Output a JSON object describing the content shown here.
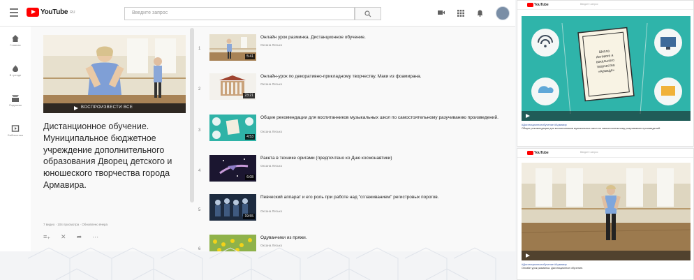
{
  "app": {
    "logo_text": "YouTube",
    "logo_region": "RU",
    "search_placeholder": "Введите запрос",
    "brand_color": "#ff0000"
  },
  "icons": {
    "menu": "menu-icon",
    "search": "search-icon",
    "camera": "video-camera-icon",
    "apps": "apps-grid-icon",
    "bell": "bell-icon"
  },
  "leftnav": [
    {
      "icon": "home-icon",
      "label": "Главная"
    },
    {
      "icon": "fire-icon",
      "label": "В тренде"
    },
    {
      "icon": "subscriptions-icon",
      "label": "Подписки"
    },
    {
      "icon": "library-icon",
      "label": "Библиотека"
    }
  ],
  "playlist": {
    "play_all": "ВОСПРОИЗВЕСТИ ВСЕ",
    "title": "Дистанционное обучение. Муниципальное бюджетное учреждение дополнительного образования Дворец детского и юношеского творчества города Армавира.",
    "meta": "7 видео · 104 просмотра · Обновлено вчера"
  },
  "videos": [
    {
      "idx": "1",
      "title": "Онлайн урок разминка. Дистанционное обучение.",
      "channel": "Оксана Лесько",
      "duration": "5:41"
    },
    {
      "idx": "2",
      "title": "Онлайн-урок по декоративно-прикладному творчеству. Маки из фоамирана.",
      "channel": "Оксана Лесько",
      "duration": "23:21"
    },
    {
      "idx": "3",
      "title": "Общие рекомендации для воспитанников музыкальных школ по самостоятельному разучиванию произведений.",
      "channel": "Оксана Лесько",
      "duration": "4:53"
    },
    {
      "idx": "4",
      "title": "Ракета в технике оригами (предпочтено ко Дню космонавтики)",
      "channel": "Оксана Лесько",
      "duration": "6:08"
    },
    {
      "idx": "5",
      "title": "Певческий аппарат и его роль при работе над \"сглаживанием\" регистровых порогов.",
      "channel": "Оксана Лесько",
      "duration": "19:55"
    },
    {
      "idx": "6",
      "title": "Одуванчики из пряжи.",
      "channel": "Оксана Лесько",
      "duration": ""
    }
  ],
  "side_panels": [
    {
      "search_placeholder": "Введите запрос",
      "board_text": [
        "Школа",
        "Актового и",
        "вокального",
        "творчества",
        "«Армада»"
      ],
      "tag_line": "#Дистанционноеобучение #Армавир",
      "caption": "Общие рекомендации для воспитанников музыкальных школ по самостоятельному разучиванию произведений."
    },
    {
      "search_placeholder": "Введите запрос",
      "tag_line": "#Дистанционноеобучение #Армавир",
      "caption": "Онлайн урок разминка. Дистанционное обучение."
    }
  ]
}
